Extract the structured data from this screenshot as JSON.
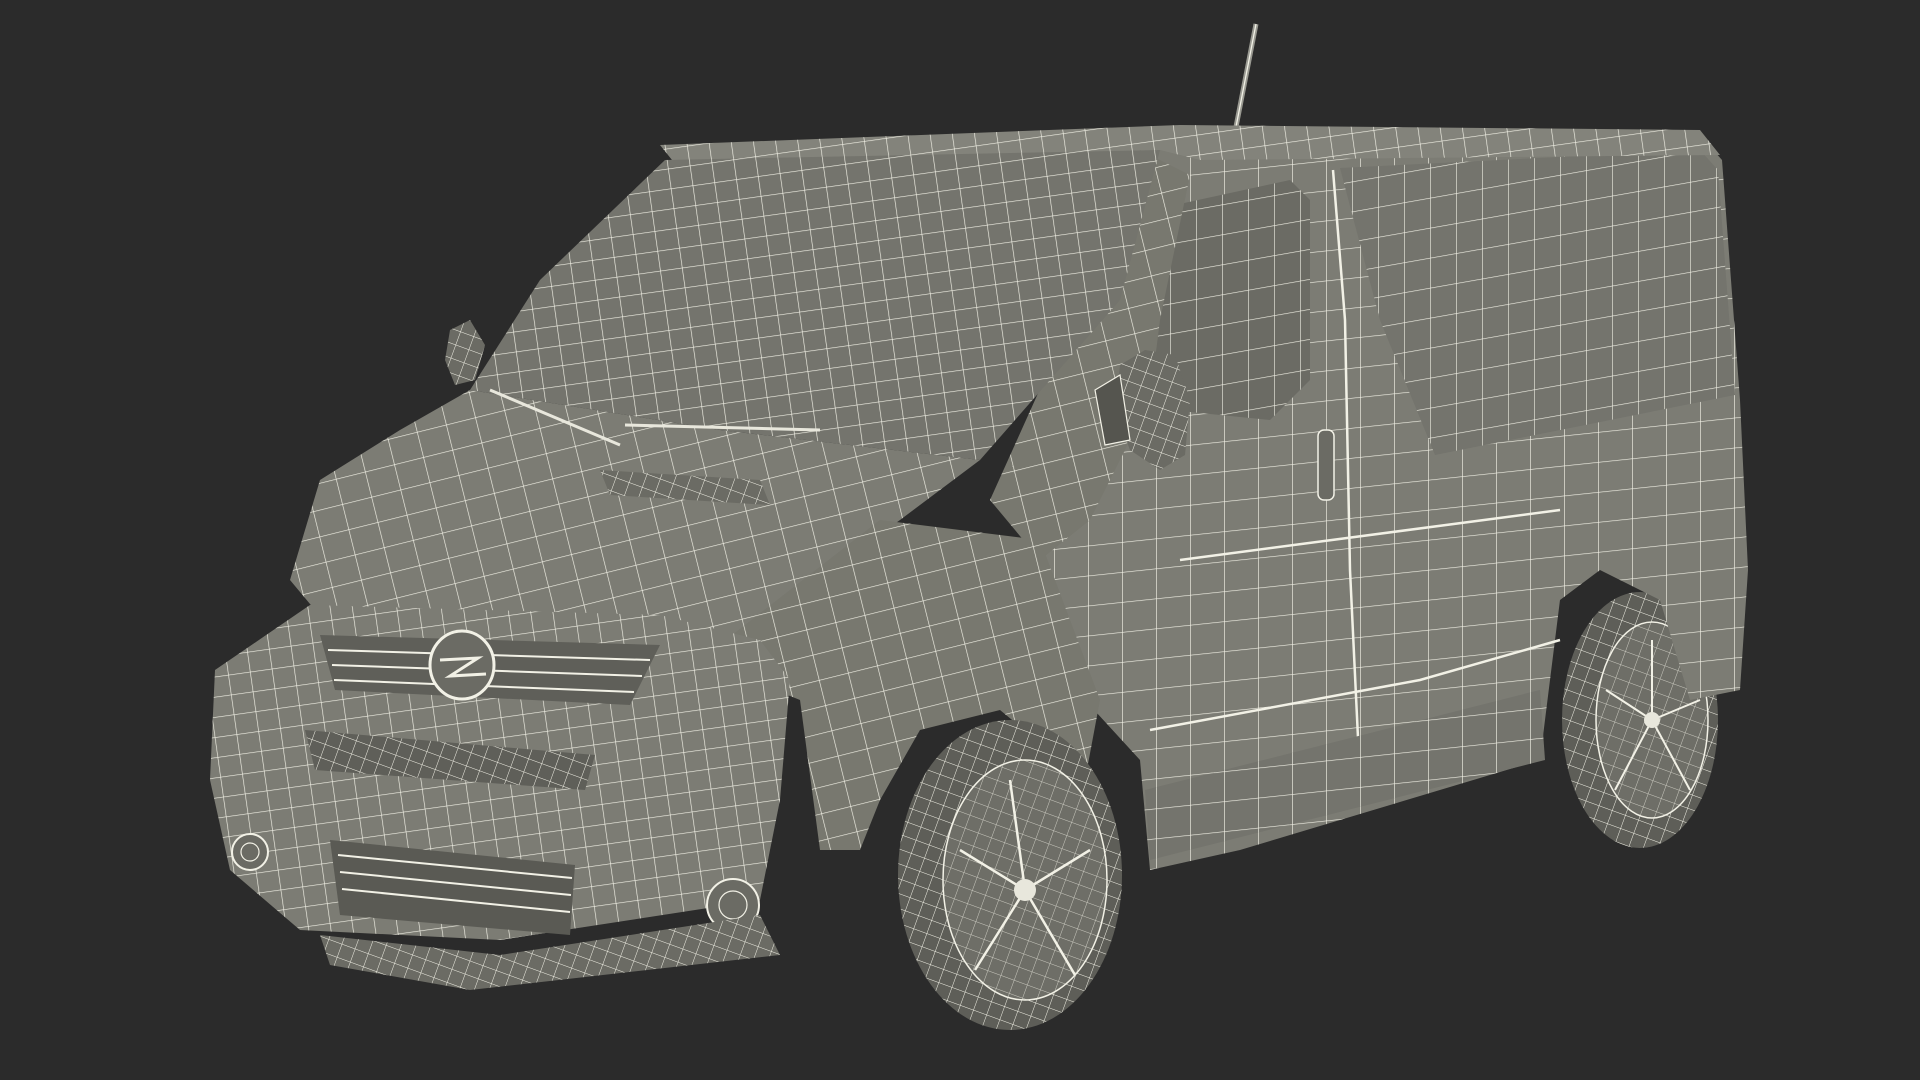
{
  "scene": {
    "background": "#2b2b2b",
    "surface_color": "#7c7c74",
    "surface_shade": "#6b6b64",
    "surface_dark": "#55554f",
    "wire_color": "#f2f1e6",
    "tire_color": "#5e5e58"
  },
  "model": {
    "type": "van",
    "render_style": "wireframe-on-shaded",
    "brand_emblem": "lightning-ring-icon"
  }
}
